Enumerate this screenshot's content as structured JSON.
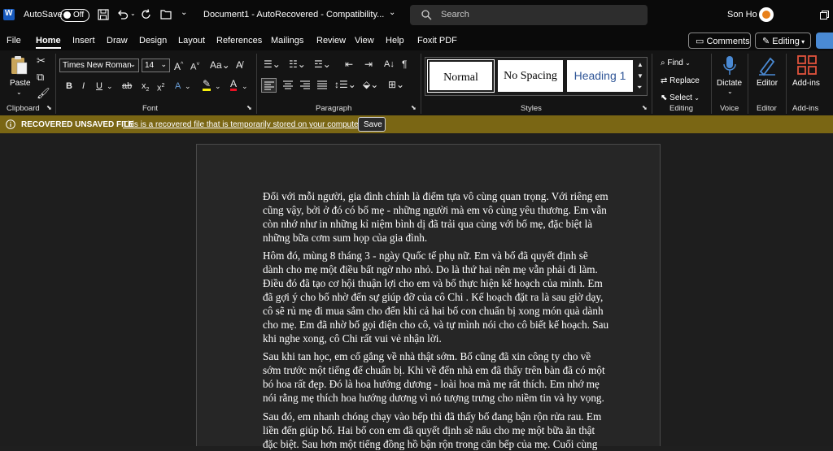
{
  "titlebar": {
    "autosave_label": "AutoSave",
    "autosave_state": "Off",
    "doc_title": "Document1 - AutoRecovered - Compatibility...",
    "search_placeholder": "Search",
    "user_name": "Son Ho"
  },
  "menu": {
    "items": [
      "File",
      "Home",
      "Insert",
      "Draw",
      "Design",
      "Layout",
      "References",
      "Mailings",
      "Review",
      "View",
      "Help",
      "Foxit PDF"
    ],
    "active": "Home",
    "comments_label": "Comments",
    "editing_label": "Editing"
  },
  "ribbon": {
    "clipboard": {
      "paste_label": "Paste",
      "group_label": "Clipboard"
    },
    "font": {
      "font_name": "Times New Roman",
      "font_size": "14",
      "group_label": "Font"
    },
    "paragraph": {
      "group_label": "Paragraph"
    },
    "styles": {
      "items": [
        "Normal",
        "No Spacing",
        "Heading 1"
      ],
      "group_label": "Styles"
    },
    "editing": {
      "find_label": "Find",
      "replace_label": "Replace",
      "select_label": "Select",
      "group_label": "Editing"
    },
    "voice": {
      "dictate_label": "Dictate",
      "group_label": "Voice"
    },
    "editor": {
      "editor_label": "Editor",
      "group_label": "Editor"
    },
    "addins": {
      "label": "Add-ins",
      "group_label": "Add-ins"
    }
  },
  "infobar": {
    "title": "RECOVERED UNSAVED FILE",
    "message": "This is a recovered file that is temporarily stored on your computer.",
    "save_label": "Save"
  },
  "document": {
    "paragraphs": [
      [
        "Đối với mỗi người, gia đình chính là điểm tựa vô cùng quan trọng. Với riêng em",
        "cũng vậy, bởi ở đó có bố mẹ - những người mà em vô cùng yêu thương. Em vẫn",
        "còn nhớ như in những kỉ niệm bình dị đã trải qua cùng với bố mẹ, đặc biệt là",
        "những bữa cơm sum họp của gia đình."
      ],
      [
        "Hôm đó, mùng 8 tháng 3 - ngày Quốc tế phụ nữ. Em và bố đã quyết định sẽ",
        "dành cho mẹ một điều bất ngờ nho nhỏ. Do là thứ hai nên mẹ vẫn phải đi làm.",
        "Điều đó đã tạo cơ hội thuận lợi cho em và bố thực hiện kế hoạch của mình. Em",
        "đã gợi ý cho bố nhờ đến sự giúp đỡ của cô Chi . Kế hoạch đặt ra là sau giờ dạy,",
        "cô sẽ rủ mẹ đi mua sắm cho đến khi cả hai bố con chuẩn bị xong món quà dành",
        "cho mẹ. Em đã nhờ bố gọi điện cho cô, và tự mình nói cho cô biết kế hoạch. Sau",
        "khi nghe xong, cô Chi rất vui vẻ nhận lời."
      ],
      [
        "Sau khi tan học, em cố gắng về nhà thật sớm. Bố cũng đã xin công ty cho về",
        "sớm trước một tiếng để chuẩn bị. Khi về đến nhà em đã thấy trên bàn đã có một",
        "bó hoa rất đẹp. Đó là hoa hướng dương - loài hoa mà mẹ rất thích. Em nhớ mẹ",
        "nói rằng mẹ thích hoa hướng dương vì nó tượng trưng cho niềm tin và hy vọng."
      ],
      [
        "Sau đó, em nhanh chóng chạy vào bếp thì đã thấy bố đang bận rộn rửa rau. Em",
        "liền đến giúp bố. Hai bố con em đã quyết định sẽ nấu cho mẹ một bữa ăn thật",
        "đặc biệt. Sau hơn một tiếng đồng hồ bận rộn trong căn bếp của mẹ. Cuối cùng"
      ]
    ]
  }
}
